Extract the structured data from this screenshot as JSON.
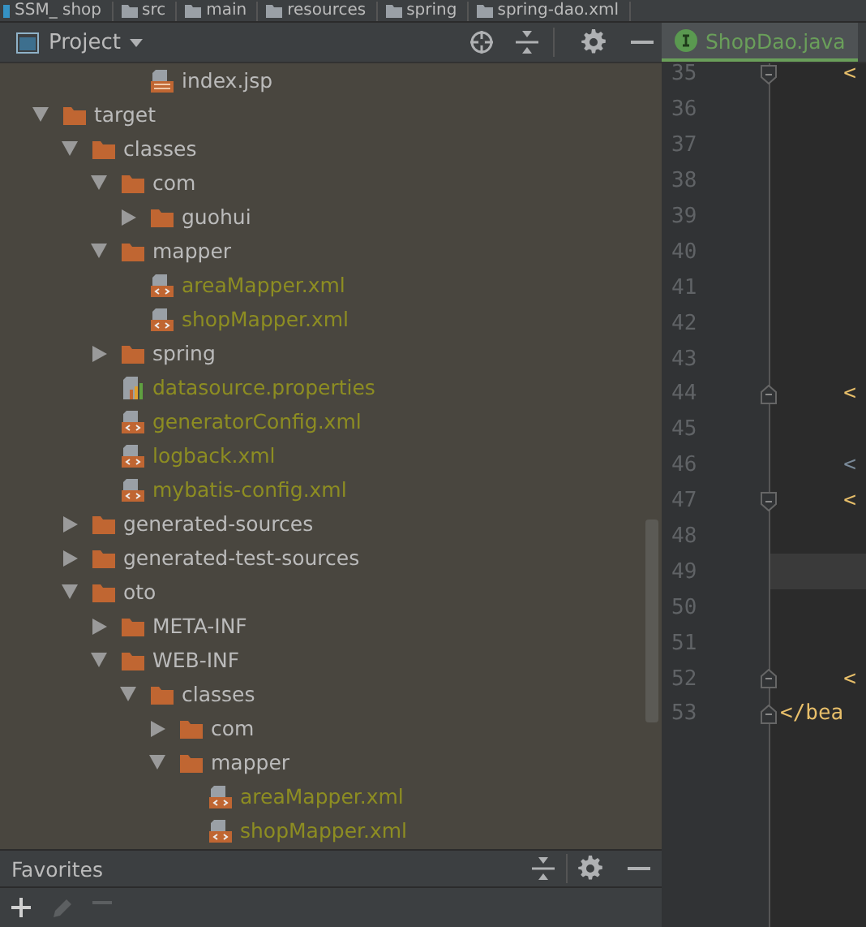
{
  "breadcrumbs": [
    "SSM_ shop",
    "src",
    "main",
    "resources",
    "spring",
    "spring-dao.xml"
  ],
  "project_panel": {
    "title": "Project",
    "tree": [
      {
        "label": "index.jsp",
        "kind": "jsp",
        "ignored": false
      },
      {
        "label": "target",
        "kind": "folder",
        "expanded": true,
        "children": [
          {
            "label": "classes",
            "kind": "folder",
            "expanded": true,
            "children": [
              {
                "label": "com",
                "kind": "folder",
                "expanded": true,
                "children": [
                  {
                    "label": "guohui",
                    "kind": "folder",
                    "expanded": false
                  }
                ]
              },
              {
                "label": "mapper",
                "kind": "folder",
                "expanded": true,
                "children": [
                  {
                    "label": "areaMapper.xml",
                    "kind": "xml",
                    "ignored": true
                  },
                  {
                    "label": "shopMapper.xml",
                    "kind": "xml",
                    "ignored": true
                  }
                ]
              },
              {
                "label": "spring",
                "kind": "folder",
                "expanded": false
              },
              {
                "label": "datasource.properties",
                "kind": "properties",
                "ignored": true
              },
              {
                "label": "generatorConfig.xml",
                "kind": "xml",
                "ignored": true
              },
              {
                "label": "logback.xml",
                "kind": "xml",
                "ignored": true
              },
              {
                "label": "mybatis-config.xml",
                "kind": "xml",
                "ignored": true
              }
            ]
          },
          {
            "label": "generated-sources",
            "kind": "folder",
            "expanded": false
          },
          {
            "label": "generated-test-sources",
            "kind": "folder",
            "expanded": false
          },
          {
            "label": "oto",
            "kind": "folder",
            "expanded": true,
            "children": [
              {
                "label": "META-INF",
                "kind": "folder",
                "expanded": false
              },
              {
                "label": "WEB-INF",
                "kind": "folder",
                "expanded": true,
                "children": [
                  {
                    "label": "classes",
                    "kind": "folder",
                    "expanded": true,
                    "children": [
                      {
                        "label": "com",
                        "kind": "folder",
                        "expanded": false
                      },
                      {
                        "label": "mapper",
                        "kind": "folder",
                        "expanded": true,
                        "children": [
                          {
                            "label": "areaMapper.xml",
                            "kind": "xml",
                            "ignored": true
                          },
                          {
                            "label": "shopMapper.xml",
                            "kind": "xml",
                            "ignored": true
                          }
                        ]
                      }
                    ]
                  }
                ]
              }
            ]
          }
        ]
      }
    ]
  },
  "editor": {
    "tab": {
      "label": "ShopDao.java",
      "selected": true
    },
    "lines": [
      {
        "number": "35",
        "code": "     <",
        "kind": "tag",
        "fold_open": true,
        "fold_close": false
      },
      {
        "number": "36",
        "fold_open": false,
        "fold_close": false
      },
      {
        "number": "37",
        "fold_open": false,
        "fold_close": false
      },
      {
        "number": "38",
        "fold_open": false,
        "fold_close": false
      },
      {
        "number": "39",
        "fold_open": false,
        "fold_close": false
      },
      {
        "number": "40",
        "fold_open": false,
        "fold_close": false
      },
      {
        "number": "41",
        "fold_open": false,
        "fold_close": false
      },
      {
        "number": "42",
        "fold_open": false,
        "fold_close": false
      },
      {
        "number": "43",
        "fold_open": false,
        "fold_close": false
      },
      {
        "number": "44",
        "code": "     <",
        "kind": "tag",
        "fold_open": false,
        "fold_close": true
      },
      {
        "number": "45",
        "fold_open": false,
        "fold_close": false
      },
      {
        "number": "46",
        "code": "     <",
        "kind": "muted",
        "fold_open": false,
        "fold_close": false
      },
      {
        "number": "47",
        "code": "     <",
        "kind": "tag",
        "fold_open": true,
        "fold_close": false
      },
      {
        "number": "48",
        "fold_open": false,
        "fold_close": false
      },
      {
        "number": "49",
        "fold_open": false,
        "fold_close": false,
        "current": true
      },
      {
        "number": "50",
        "fold_open": false,
        "fold_close": false
      },
      {
        "number": "51",
        "fold_open": false,
        "fold_close": false
      },
      {
        "number": "52",
        "code": "     <",
        "kind": "tag",
        "fold_open": false,
        "fold_close": true
      },
      {
        "number": "53",
        "code": "</bea",
        "kind": "tag",
        "fold_open": false,
        "fold_close": true
      }
    ]
  },
  "favorites_panel": {
    "title": "Favorites"
  }
}
